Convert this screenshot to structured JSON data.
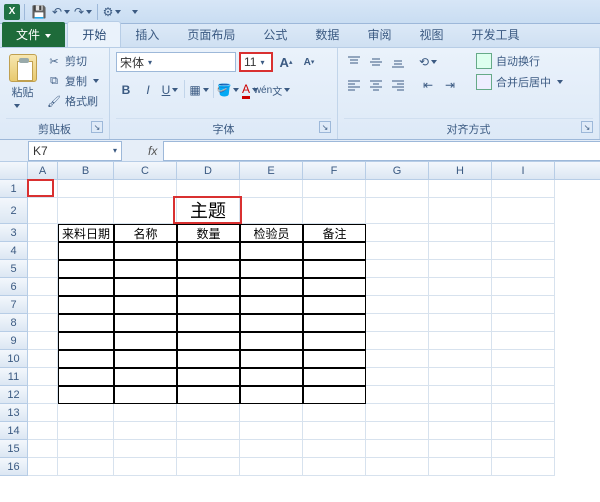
{
  "qat": {
    "save": "💾",
    "undo": "↶",
    "redo": "↷"
  },
  "tabs": {
    "file": "文件",
    "items": [
      "开始",
      "插入",
      "页面布局",
      "公式",
      "数据",
      "审阅",
      "视图",
      "开发工具"
    ],
    "active": 0
  },
  "ribbon": {
    "clipboard": {
      "label": "剪贴板",
      "paste": "粘贴",
      "cut": "剪切",
      "copy": "复制",
      "format_painter": "格式刷"
    },
    "font": {
      "label": "字体",
      "name": "宋体",
      "size": "11",
      "grow": "A",
      "shrink": "A",
      "bold": "B",
      "italic": "I",
      "underline": "U"
    },
    "align": {
      "label": "对齐方式",
      "wrap": "自动换行",
      "merge": "合并后居中"
    }
  },
  "namebox": "K7",
  "fx": "fx",
  "columns": [
    "A",
    "B",
    "C",
    "D",
    "E",
    "F",
    "G",
    "H",
    "I"
  ],
  "rows_count": 16,
  "sheet": {
    "title": "主题",
    "headers": [
      "来料日期",
      "名称",
      "数量",
      "检验员",
      "备注"
    ]
  }
}
